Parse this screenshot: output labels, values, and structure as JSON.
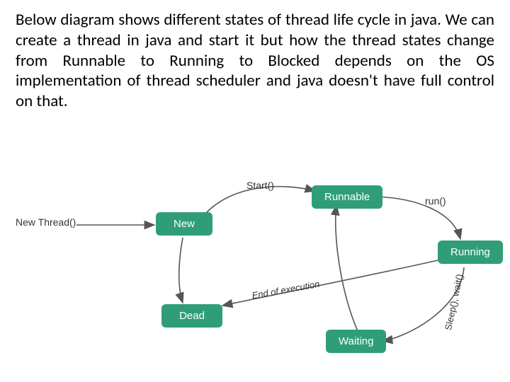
{
  "intro_text": "Below diagram shows different states of thread life cycle in java. We can create a thread in java and start it but how the thread states change from Runnable to Running to Blocked depends on the OS implementation of thread scheduler and java doesn't have full control on that.",
  "labels": {
    "new_thread": "New Thread()",
    "start": "Start()",
    "run": "run()",
    "end_exec": "End of execution",
    "sleep_wait": "Sleep(), wait()"
  },
  "nodes": {
    "new": "New",
    "runnable": "Runnable",
    "running": "Running",
    "waiting": "Waiting",
    "dead": "Dead"
  },
  "diagram_meta": {
    "title": "Thread life cycle states (Java)",
    "type": "state-diagram",
    "states": [
      "New",
      "Runnable",
      "Running",
      "Waiting",
      "Dead"
    ],
    "transitions": [
      {
        "from": "(external)",
        "to": "New",
        "label": "New Thread()"
      },
      {
        "from": "New",
        "to": "Runnable",
        "label": "Start()"
      },
      {
        "from": "Runnable",
        "to": "Running",
        "label": "run()"
      },
      {
        "from": "Running",
        "to": "Waiting",
        "label": "Sleep(), wait()"
      },
      {
        "from": "Waiting",
        "to": "Runnable",
        "label": ""
      },
      {
        "from": "Running",
        "to": "Dead",
        "label": "End of execution"
      },
      {
        "from": "New",
        "to": "Dead",
        "label": ""
      }
    ]
  }
}
